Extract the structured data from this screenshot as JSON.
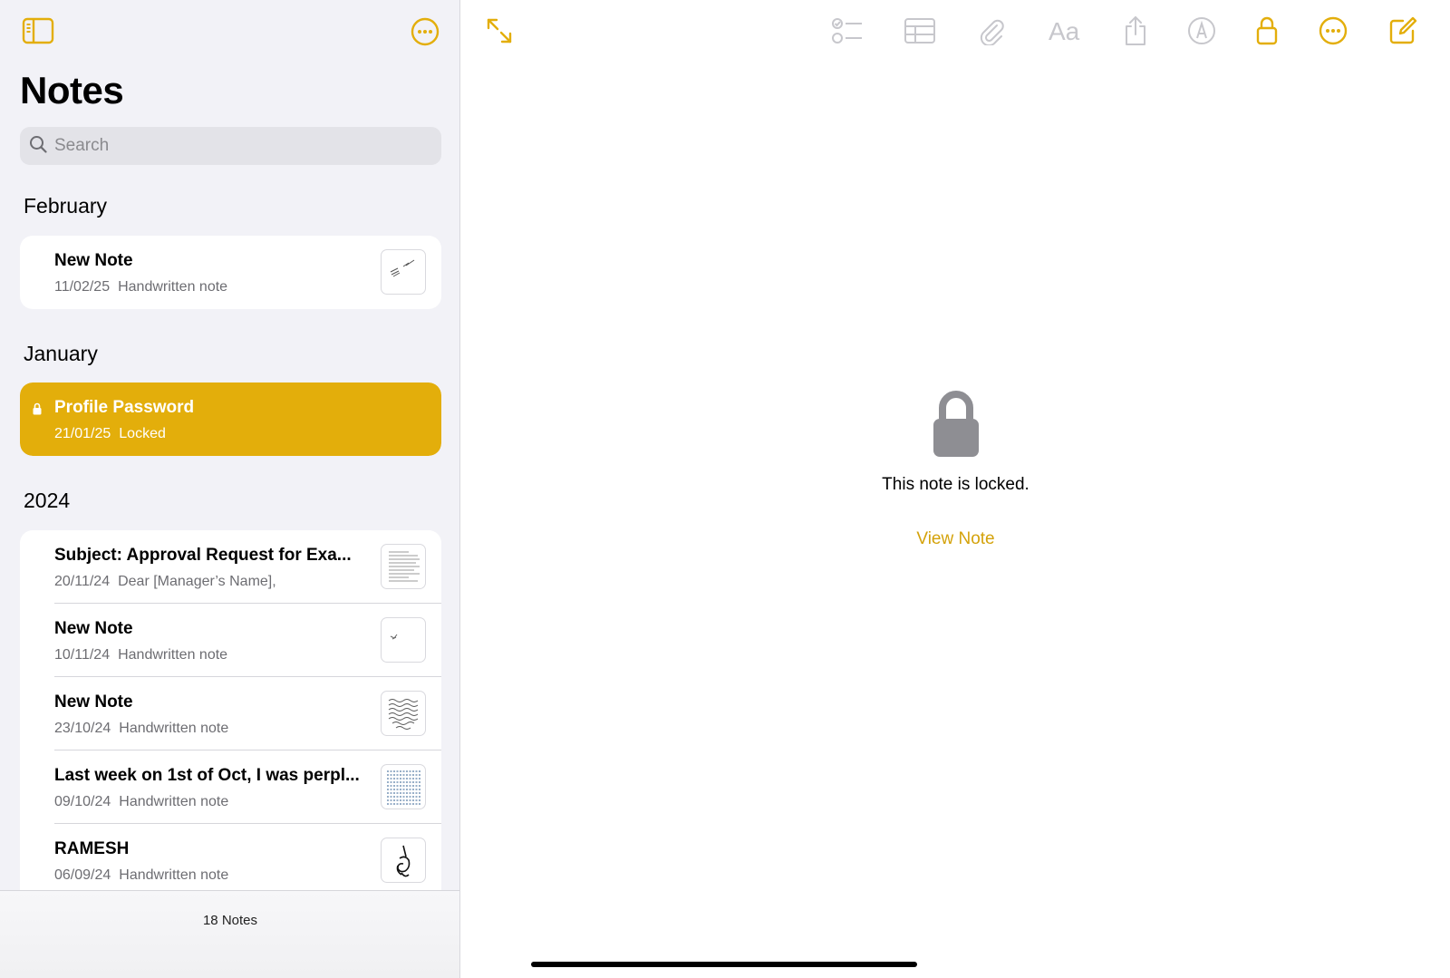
{
  "sidebar": {
    "title": "Notes",
    "search_placeholder": "Search",
    "sections": [
      {
        "heading": "February",
        "notes": [
          {
            "title": "New Note",
            "date": "11/02/25",
            "preview": "Handwritten note"
          }
        ]
      },
      {
        "heading": "January",
        "notes": [
          {
            "title": "Profile Password",
            "date": "21/01/25",
            "preview": "Locked",
            "locked": true,
            "selected": true
          }
        ]
      },
      {
        "heading": "2024",
        "notes": [
          {
            "title": "Subject: Approval Request for Exa...",
            "date": "20/11/24",
            "preview": "Dear [Manager’s Name],"
          },
          {
            "title": "New Note",
            "date": "10/11/24",
            "preview": "Handwritten note"
          },
          {
            "title": "New Note",
            "date": "23/10/24",
            "preview": "Handwritten note"
          },
          {
            "title": "Last week on 1st of Oct, I was perpl...",
            "date": "09/10/24",
            "preview": "Handwritten note"
          },
          {
            "title": "RAMESH",
            "date": "06/09/24",
            "preview": "Handwritten note"
          }
        ]
      }
    ],
    "note_count": "18 Notes"
  },
  "main": {
    "locked_message": "This note is locked.",
    "view_note_label": "View Note"
  },
  "icons": {
    "sidebar_toggle": "sidebar-toggle-icon",
    "more": "ellipsis-circle-icon",
    "expand": "expand-arrows-icon",
    "checklist": "checklist-icon",
    "table": "table-icon",
    "attachment": "paperclip-icon",
    "format": "text-format-icon",
    "share": "share-icon",
    "markup": "markup-pen-icon",
    "lock": "lock-icon",
    "compose": "compose-icon"
  },
  "colors": {
    "accent": "#e3ae0b",
    "disabled_icon": "#c7c7cc",
    "lock_gray": "#8e8e93"
  }
}
